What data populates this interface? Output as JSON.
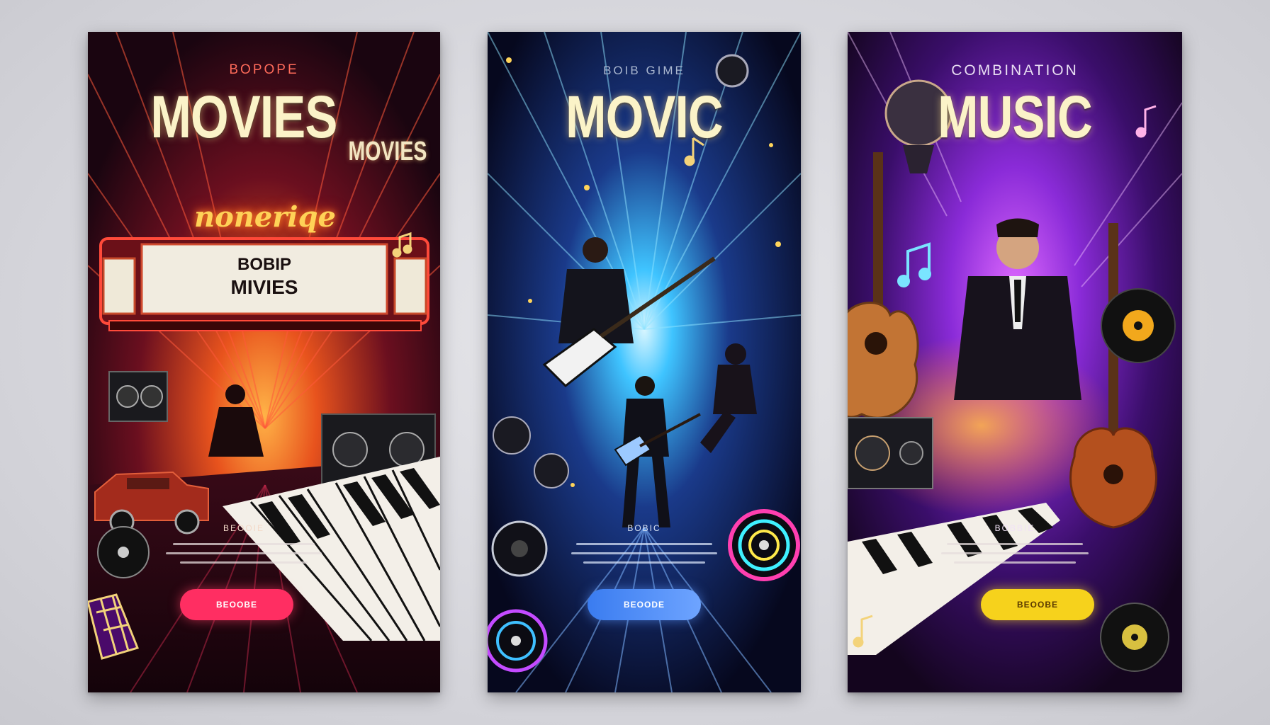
{
  "posters": [
    {
      "subtitle": "BOPOPE",
      "title": "MOVIES",
      "side_title": "MOVIES",
      "neon_sign": "noneriqe",
      "marquee_line1": "BOBIP",
      "marquee_line2": "MIVIES",
      "small_label": "BEOOIE",
      "button_label": "BEOOBE",
      "accent": "#ff2e62"
    },
    {
      "subtitle": "BOIB GIME",
      "title": "MOVIC",
      "small_label": "BOBIC",
      "button_label": "BEOODE",
      "accent": "#4e86f0"
    },
    {
      "subtitle": "COMBINATION",
      "title": "MUSIC",
      "small_label": "BOBBIE",
      "button_label": "BEOOBE",
      "accent": "#f6d21c"
    }
  ]
}
